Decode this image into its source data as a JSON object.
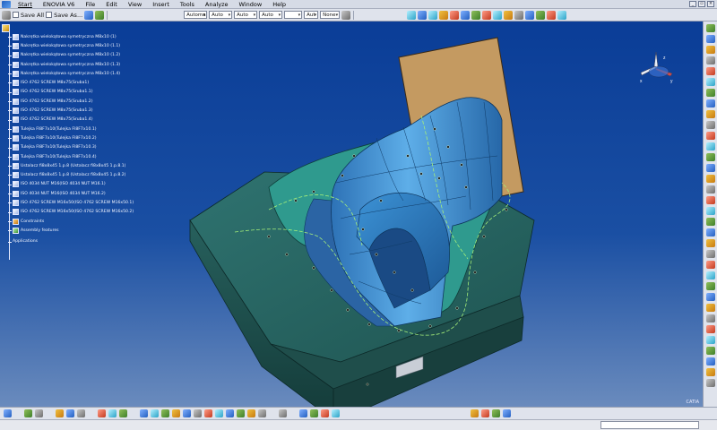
{
  "app": {
    "brand": "CATIA"
  },
  "menu": {
    "items": [
      "Start",
      "ENOVIA V6",
      "File",
      "Edit",
      "View",
      "Insert",
      "Tools",
      "Analyze",
      "Window",
      "Help"
    ]
  },
  "toolbar": {
    "save_all": "Save All",
    "save_as": "Save As...",
    "selects": [
      "Automa",
      "Auto",
      "Auto",
      "Auto",
      "",
      "Aut",
      "None"
    ]
  },
  "tree": {
    "items": [
      {
        "label": "Nakrętka wielokątowa symetryczna M8x10 (1)",
        "type": "part"
      },
      {
        "label": "Nakrętka wielokątowa symetryczna M8x10 (1.1)",
        "type": "part"
      },
      {
        "label": "Nakrętka wielokątowa symetryczna M8x10 (1.2)",
        "type": "part"
      },
      {
        "label": "Nakrętka wielokątowa symetryczna M8x10 (1.3)",
        "type": "part"
      },
      {
        "label": "Nakrętka wielokątowa symetryczna M8x10 (1.4)",
        "type": "part"
      },
      {
        "label": "ISO 4762 SCREW M8x75(Sruba1)",
        "type": "part"
      },
      {
        "label": "ISO 4762 SCREW M8x75(Sruba1.1)",
        "type": "part"
      },
      {
        "label": "ISO 4762 SCREW M8x75(Sruba1.2)",
        "type": "part"
      },
      {
        "label": "ISO 4762 SCREW M8x75(Sruba1.3)",
        "type": "part"
      },
      {
        "label": "ISO 4762 SCREW M8x75(Sruba1.4)",
        "type": "part"
      },
      {
        "label": "Tulejka FI8F7x10(Tulejka FI8F7x10.1)",
        "type": "part"
      },
      {
        "label": "Tulejka FI8F7x10(Tulejka FI8F7x10.2)",
        "type": "part"
      },
      {
        "label": "Tulejka FI8F7x10(Tulejka FI8F7x10.3)",
        "type": "part"
      },
      {
        "label": "Tulejka FI8F7x10(Tulejka FI8F7x10.4)",
        "type": "part"
      },
      {
        "label": "Ustalacz fi8x8x45 1.p.8 (Ustalacz fi8x8x45 1.p.8.1)",
        "type": "part"
      },
      {
        "label": "Ustalacz fi8x8x45 1.p.8 (Ustalacz fi8x8x45 1.p.8.2)",
        "type": "part"
      },
      {
        "label": "ISO 4034 NUT M16(ISO 4034 NUT M16.1)",
        "type": "part"
      },
      {
        "label": "ISO 4034 NUT M16(ISO 4034 NUT M16.2)",
        "type": "part"
      },
      {
        "label": "ISO 4762 SCREW M16x50(ISO 4762 SCREW M16x50.1)",
        "type": "part"
      },
      {
        "label": "ISO 4762 SCREW M16x50(ISO 4762 SCREW M16x50.2)",
        "type": "part"
      },
      {
        "label": "Constraints",
        "type": "constraints"
      },
      {
        "label": "Assembly features",
        "type": "assembly"
      }
    ],
    "applications": "Applications"
  },
  "compass": {
    "x": "x",
    "y": "y",
    "z": "z"
  },
  "colors": {
    "viewport_top": "#0a3d97",
    "viewport_bottom": "#6a8bbd",
    "mold_base": "#2e6c6a",
    "mold_surface": "#3b86c9",
    "plate": "#c49a61",
    "path": "#a6f07a"
  }
}
